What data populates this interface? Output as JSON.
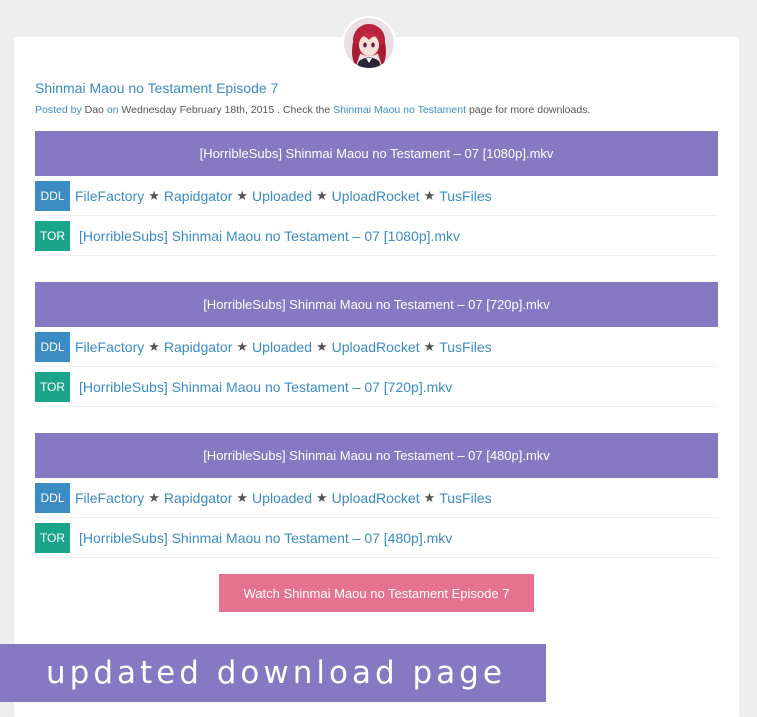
{
  "post": {
    "title": "Shinmai Maou no Testament Episode 7",
    "meta": {
      "posted_by": "Posted by",
      "author": "Dao",
      "on": "on",
      "date": "Wednesday February 18th, 2015",
      "check": ". Check the",
      "page_link": "Shinmai Maou no Testament",
      "suffix": "page for more downloads."
    }
  },
  "sections": [
    {
      "banner": "[HorribleSubs] Shinmai Maou no Testament – 07 [1080p].mkv",
      "ddl_badge": "DDL",
      "tor_badge": "TOR",
      "hosts": [
        "FileFactory",
        "Rapidgator",
        "Uploaded",
        "UploadRocket",
        "TusFiles"
      ],
      "torrent": "[HorribleSubs] Shinmai Maou no Testament – 07 [1080p].mkv"
    },
    {
      "banner": "[HorribleSubs] Shinmai Maou no Testament – 07 [720p].mkv",
      "ddl_badge": "DDL",
      "tor_badge": "TOR",
      "hosts": [
        "FileFactory",
        "Rapidgator",
        "Uploaded",
        "UploadRocket",
        "TusFiles"
      ],
      "torrent": "[HorribleSubs] Shinmai Maou no Testament – 07 [720p].mkv"
    },
    {
      "banner": "[HorribleSubs] Shinmai Maou no Testament – 07 [480p].mkv",
      "ddl_badge": "DDL",
      "tor_badge": "TOR",
      "hosts": [
        "FileFactory",
        "Rapidgator",
        "Uploaded",
        "UploadRocket",
        "TusFiles"
      ],
      "torrent": "[HorribleSubs] Shinmai Maou no Testament – 07 [480p].mkv"
    }
  ],
  "watch_button": "Watch Shinmai Maou no Testament Episode 7",
  "overlay_caption": "updated download page",
  "colors": {
    "banner": "#8778c4",
    "ddl": "#3b8bc4",
    "tor": "#1aa489",
    "watch": "#e5738f",
    "link": "#3b8bc4"
  },
  "icons": {
    "avatar": "anime-avatar",
    "separator": "star"
  }
}
